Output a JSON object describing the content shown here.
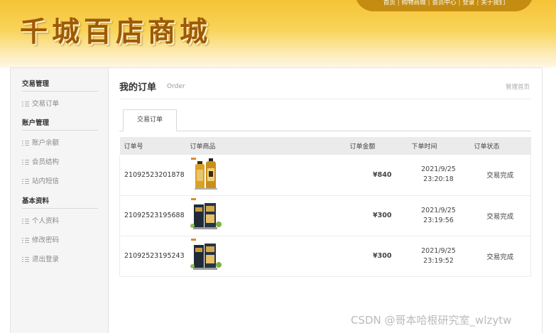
{
  "header": {
    "logo_text": "千城百店商城",
    "nav": [
      "首页",
      "购物商城",
      "会员中心",
      "登录",
      "关于我们"
    ],
    "nav_separator": "|",
    "colors": {
      "header_top": "#f6c336",
      "nav_bg": "#c48d12",
      "logo": "#9e5a07"
    }
  },
  "sidebar": {
    "groups": [
      {
        "title": "交易管理",
        "items": [
          "交易订单"
        ]
      },
      {
        "title": "账户管理",
        "items": [
          "账户余额",
          "会员结构",
          "站内短信"
        ]
      },
      {
        "title": "基本资料",
        "items": [
          "个人资料",
          "修改密码",
          "退出登录"
        ]
      }
    ]
  },
  "main": {
    "title": "我的订单",
    "subtitle": "Order",
    "home_link": "管理首页",
    "tab": "交易订单",
    "columns": [
      "订单号",
      "订单商品",
      "订单金额",
      "下单时间",
      "订单状态"
    ],
    "orders": [
      {
        "id": "21092523201878",
        "product_icon": "shampoo-bottles-icon",
        "amount": "¥840",
        "date": "2021/9/25",
        "time": "23:20:18",
        "status": "交易完成"
      },
      {
        "id": "21092523195688",
        "product_icon": "shampoo-gift-box-icon",
        "amount": "¥300",
        "date": "2021/9/25",
        "time": "23:19:56",
        "status": "交易完成"
      },
      {
        "id": "21092523195243",
        "product_icon": "shampoo-gift-box-icon",
        "amount": "¥300",
        "date": "2021/9/25",
        "time": "23:19:52",
        "status": "交易完成"
      }
    ]
  },
  "watermark": "CSDN @哥本哈根研究室_wlzytw"
}
